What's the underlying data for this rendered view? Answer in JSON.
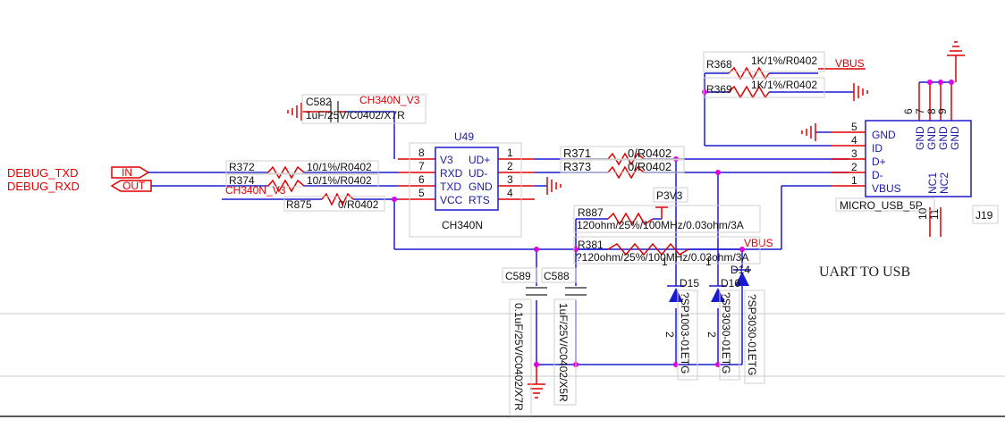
{
  "net_labels": {
    "debug_txd": "DEBUG_TXD",
    "debug_rxd": "DEBUG_RXD",
    "port_in": "IN",
    "port_out": "OUT",
    "ch340n_v3_top": "CH340N_V3",
    "ch340n_v3_left": "CH340N_V3",
    "vbus_top": "VBUS",
    "vbus_mid": "VBUS",
    "p3v3": "P3V3"
  },
  "components": {
    "c582": {
      "ref": "C582",
      "value": "1uF/25V/C0402/X7R"
    },
    "u49": {
      "ref": "U49",
      "part": "CH340N",
      "left_pins": [
        {
          "num": "8",
          "name": "V3"
        },
        {
          "num": "7",
          "name": "RXD"
        },
        {
          "num": "6",
          "name": "TXD"
        },
        {
          "num": "5",
          "name": "VCC"
        }
      ],
      "right_pins": [
        {
          "num": "1",
          "name": "UD+"
        },
        {
          "num": "2",
          "name": "UD-"
        },
        {
          "num": "3",
          "name": "GND"
        },
        {
          "num": "4",
          "name": "RTS"
        }
      ]
    },
    "r372": {
      "ref": "R372",
      "value": "10/1%/R0402"
    },
    "r374": {
      "ref": "R374",
      "value": "10/1%/R0402"
    },
    "r875": {
      "ref": "R875",
      "value": "0/R0402"
    },
    "r371": {
      "ref": "R371",
      "value": "0/R0402"
    },
    "r373": {
      "ref": "R373",
      "value": "0/R0402"
    },
    "r368": {
      "ref": "R368",
      "value": "1K/1%/R0402"
    },
    "r369": {
      "ref": "R369",
      "value": "1K/1%/R0402"
    },
    "r887": {
      "ref": "R887",
      "value": "120ohm/25%/100MHz/0.03ohm/3A"
    },
    "r381": {
      "ref": "R381",
      "value": "?120ohm/25%/100MHz/0.03ohm/3A"
    },
    "c589": {
      "ref": "C589",
      "value": "0.1uF/25V/C0402/X7R"
    },
    "c588": {
      "ref": "C588",
      "value": "1uF/25V/C0402/X5R"
    },
    "d15": {
      "ref": "D15",
      "value": "?SP1003-01ETG",
      "pin_top": "1",
      "pin_bottom": "2"
    },
    "d16": {
      "ref": "D16",
      "value": "?SP3030-01ETG",
      "pin_top": "1",
      "pin_bottom": "2"
    },
    "d14": {
      "ref": "D14",
      "value": "?SP3030-01ETG"
    },
    "j19": {
      "ref": "J19",
      "part": "MICRO_USB_5P",
      "pins": [
        {
          "num": "5",
          "name": "GND"
        },
        {
          "num": "4",
          "name": "ID"
        },
        {
          "num": "3",
          "name": "D+"
        },
        {
          "num": "2",
          "name": "D-"
        },
        {
          "num": "1",
          "name": "VBUS"
        }
      ],
      "top_pins": [
        {
          "num": "6",
          "name": "GND"
        },
        {
          "num": "7",
          "name": "GND"
        },
        {
          "num": "8",
          "name": "GND"
        },
        {
          "num": "9",
          "name": "GND"
        }
      ],
      "nc_pins": [
        {
          "num": "10",
          "name": "NC1"
        },
        {
          "num": "11",
          "name": "NC2"
        }
      ]
    }
  },
  "block_title": "UART TO USB"
}
